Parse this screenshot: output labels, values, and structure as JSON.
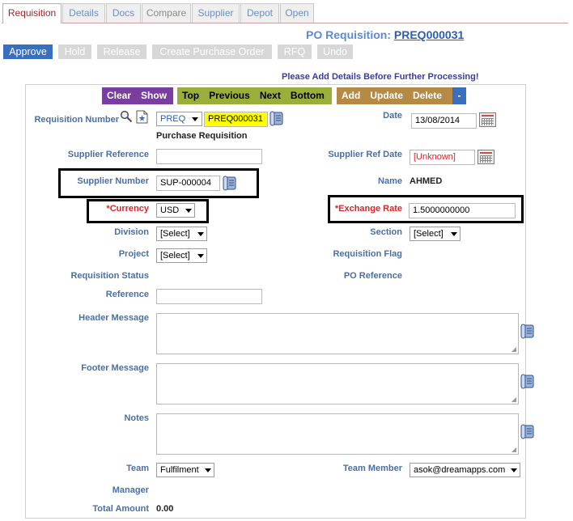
{
  "tabs": [
    {
      "label": "Requisition",
      "state": "active"
    },
    {
      "label": "Details",
      "state": "normal"
    },
    {
      "label": "Docs",
      "state": "normal"
    },
    {
      "label": "Compare",
      "state": "grey"
    },
    {
      "label": "Supplier",
      "state": "normal"
    },
    {
      "label": "Depot",
      "state": "normal"
    },
    {
      "label": "Open",
      "state": "normal"
    }
  ],
  "header": {
    "title_prefix": "PO Requisition:",
    "title_number": "PREQ000031"
  },
  "actions": {
    "approve": "Approve",
    "hold": "Hold",
    "release": "Release",
    "create_po": "Create Purchase Order",
    "rfq": "RFQ",
    "undo": "Undo"
  },
  "notice": "Please Add Details Before Further Processing!",
  "toolbar": {
    "clear": "Clear",
    "show": "Show",
    "top": "Top",
    "previous": "Previous",
    "next": "Next",
    "bottom": "Bottom",
    "add": "Add",
    "update": "Update",
    "delete": "Delete",
    "minus": "-"
  },
  "form": {
    "requisition_number_label": "Requisition Number",
    "prefix_value": "PREQ",
    "requisition_number_value": "PREQ000031",
    "requisition_type": "Purchase Requisition",
    "date_label": "Date",
    "date_value": "13/08/2014",
    "supplier_reference_label": "Supplier Reference",
    "supplier_reference_value": "",
    "supplier_ref_date_label": "Supplier Ref Date",
    "supplier_ref_date_value": "[Unknown]",
    "supplier_number_label": "Supplier Number",
    "supplier_number_value": "SUP-000004",
    "name_label": "Name",
    "name_value": "AHMED",
    "currency_label": "*Currency",
    "currency_value": "USD",
    "exchange_rate_label": "*Exchange Rate",
    "exchange_rate_value": "1.5000000000",
    "division_label": "Division",
    "division_value": "[Select]",
    "section_label": "Section",
    "section_value": "[Select]",
    "project_label": "Project",
    "project_value": "[Select]",
    "requisition_flag_label": "Requisition Flag",
    "requisition_status_label": "Requisition Status",
    "po_reference_label": "PO Reference",
    "reference_label": "Reference",
    "reference_value": "",
    "header_message_label": "Header Message",
    "footer_message_label": "Footer Message",
    "notes_label": "Notes",
    "team_label": "Team",
    "team_value": "Fulfilment",
    "team_member_label": "Team Member",
    "team_member_value": "asok@dreamapps.com",
    "manager_label": "Manager",
    "total_amount_label": "Total Amount",
    "total_amount_value": "0.00"
  },
  "colors": {
    "accent_blue": "#3a6fc0",
    "label_blue": "#4a6fa5",
    "required_red": "#d6262a",
    "toolbar_purple": "#7a3e9e",
    "toolbar_green": "#9aae3a",
    "toolbar_brown": "#b58a45",
    "highlight_yellow": "#ffff00"
  }
}
